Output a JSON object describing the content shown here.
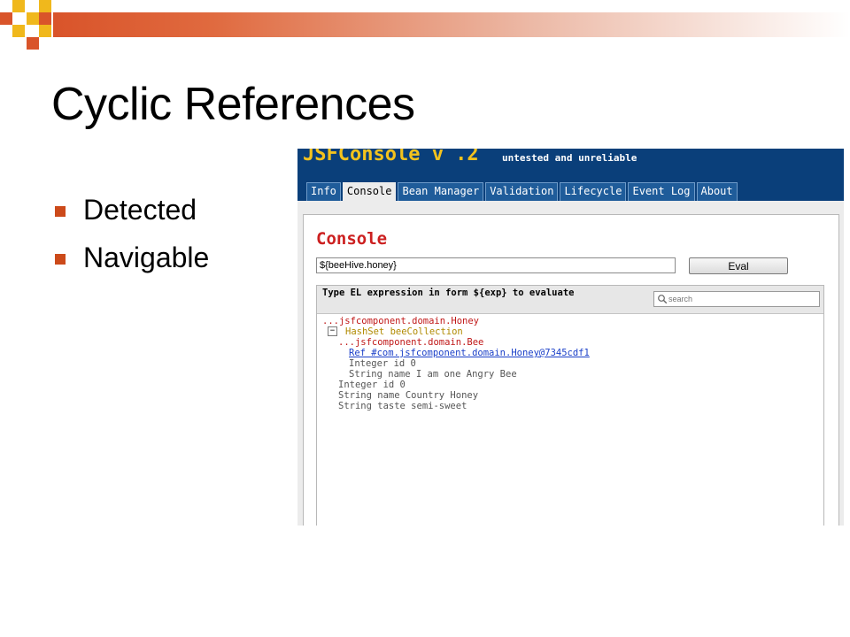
{
  "slide": {
    "title": "Cyclic References",
    "bullets": [
      "Detected",
      "Navigable"
    ]
  },
  "colors": {
    "accent_orange": "#d9542a",
    "accent_gold": "#f0b81c",
    "header_blue": "#0a3f7a",
    "heading_red": "#cc2020"
  },
  "app": {
    "name": "JSFConsole v .2",
    "tagline": "untested and unreliable",
    "tabs": [
      {
        "label": "Info",
        "active": false
      },
      {
        "label": "Console",
        "active": true
      },
      {
        "label": "Bean Manager",
        "active": false
      },
      {
        "label": "Validation",
        "active": false
      },
      {
        "label": "Lifecycle",
        "active": false
      },
      {
        "label": "Event Log",
        "active": false
      },
      {
        "label": "About",
        "active": false
      }
    ]
  },
  "console": {
    "heading": "Console",
    "expression": "${beeHive.honey}",
    "eval_label": "Eval",
    "prompt": "Type EL expression in form ${exp} to evaluate",
    "search_placeholder": "search",
    "toggle": "−",
    "tree": [
      {
        "text": "...jsfcomponent.domain.Honey",
        "style": "red"
      },
      {
        "text": "HashSet beeCollection",
        "style": "gold"
      },
      {
        "text": "...jsfcomponent.domain.Bee",
        "style": "red"
      },
      {
        "text": "Ref #com.jsfcomponent.domain.Honey@7345cdf1",
        "style": "link"
      },
      {
        "text": "Integer id 0",
        "style": "gray"
      },
      {
        "text": "String name I am one Angry Bee",
        "style": "gray"
      },
      {
        "text": "Integer id 0",
        "style": "gray"
      },
      {
        "text": "String name Country Honey",
        "style": "gray"
      },
      {
        "text": "String taste semi-sweet",
        "style": "gray"
      }
    ]
  }
}
